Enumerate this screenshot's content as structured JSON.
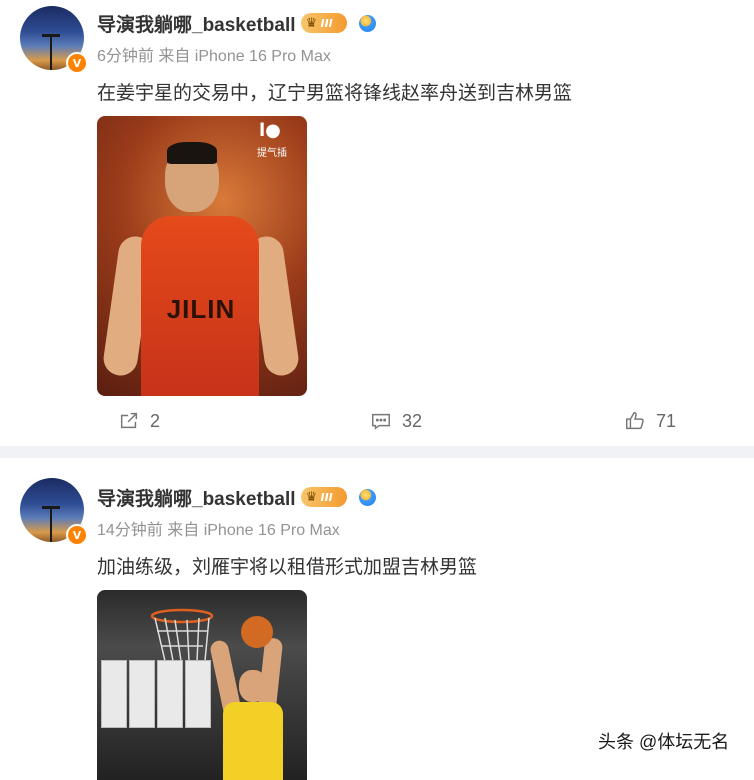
{
  "posts": [
    {
      "username": "导演我躺哪_basketball",
      "member_level": "III",
      "meta": "6分钟前 来自 iPhone 16 Pro Max",
      "text": "在姜宇星的交易中，辽宁男篮将锋线赵率舟送到吉林男篮",
      "image": {
        "jersey_text": "JILIN",
        "watermark_text": "提气插"
      },
      "actions": {
        "share_count": "2",
        "comment_count": "32",
        "like_count": "71"
      }
    },
    {
      "username": "导演我躺哪_basketball",
      "member_level": "III",
      "meta": "14分钟前 来自 iPhone 16 Pro Max",
      "text": "加油练级，刘雁宇将以租借形式加盟吉林男篮"
    }
  ],
  "verified_badge": "V",
  "footer_watermark": "头条 @体坛无名",
  "colors": {
    "accent_orange": "#ff8200",
    "meta_gray": "#939393",
    "separator": "#f1f2f5"
  },
  "icons": [
    "verified-v-icon",
    "crown-icon",
    "gold-verify-icon",
    "share-icon",
    "comment-icon",
    "like-icon"
  ]
}
